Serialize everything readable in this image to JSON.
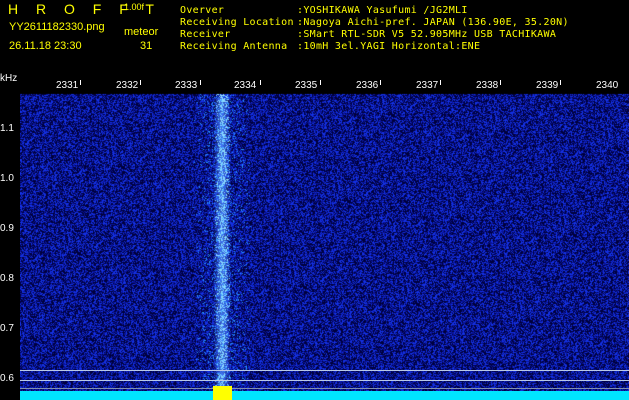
{
  "header": {
    "brand": "H R O F F T",
    "version": "1.00f",
    "filename": "YY2611182330.png",
    "datetime": "26.11.18 23:30",
    "meteor_label": "meteor",
    "meteor_count": "31",
    "rows": [
      {
        "label": "Overver",
        "value": ":YOSHIKAWA Yasufumi /JG2MLI"
      },
      {
        "label": "Receiving Location",
        "value": ":Nagoya Aichi-pref. JAPAN (136.90E, 35.20N)"
      },
      {
        "label": "Receiver",
        "value": ":SMart RTL-SDR V5 52.905MHz USB TACHIKAWA"
      },
      {
        "label": "Receiving Antenna",
        "value": ":10mH 3el.YAGI Horizontal:ENE"
      }
    ]
  },
  "axis": {
    "y_unit": "kHz",
    "x_ticks": [
      "2331",
      "2332",
      "2333",
      "2334",
      "2335",
      "2336",
      "2337",
      "2338",
      "2339",
      "2340"
    ],
    "y_ticks": [
      "1.1",
      "1.0",
      "0.9",
      "0.8",
      "0.7",
      "0.6"
    ]
  },
  "colors": {
    "label_yellow": "#ffff00",
    "baseline_cyan": "#00e5ff",
    "spectrum_dark": "#000033",
    "spectrum_blue": "#2040ff"
  }
}
